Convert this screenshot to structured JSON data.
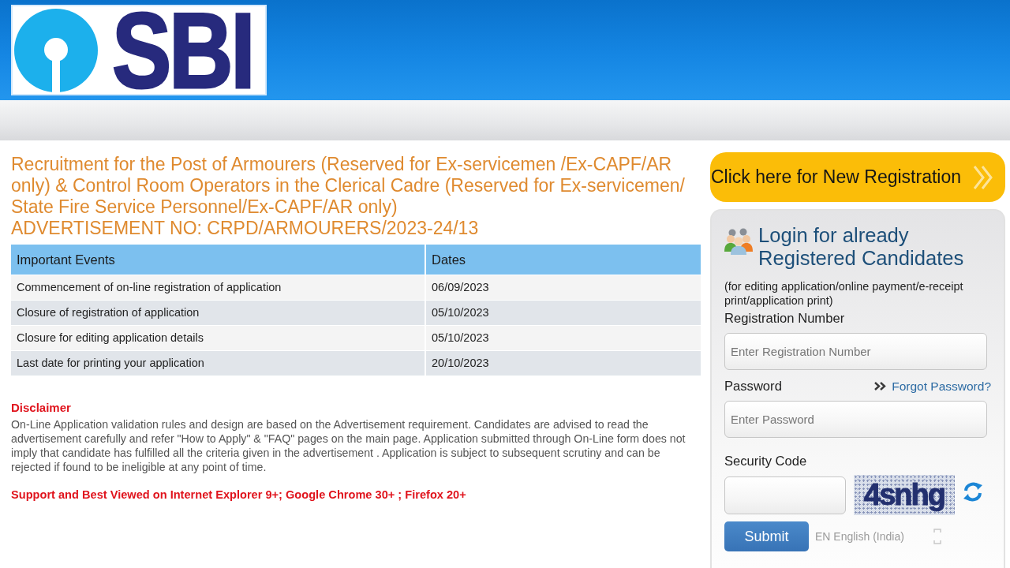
{
  "header": {
    "logo_text": "SBI"
  },
  "recruitment": {
    "title": "Recruitment for the Post of Armourers (Reserved for Ex-servicemen /Ex-CAPF/AR only) & Control Room Operators in the Clerical Cadre (Reserved for Ex-servicemen/ State Fire Service Personnel/Ex-CAPF/AR only)",
    "advertisement_no": "ADVERTISEMENT NO: CRPD/ARMOURERS/2023-24/13"
  },
  "events_table": {
    "columns": [
      "Important Events",
      "Dates"
    ],
    "rows": [
      {
        "event": "Commencement of on-line registration of application",
        "date": "06/09/2023"
      },
      {
        "event": "Closure of registration of application",
        "date": "05/10/2023"
      },
      {
        "event": "Closure for editing application details",
        "date": "05/10/2023"
      },
      {
        "event": "Last date for printing your application",
        "date": "20/10/2023"
      }
    ]
  },
  "disclaimer": {
    "heading": "Disclaimer",
    "text": "On-Line Application validation rules and design are based on the Advertisement requirement. Candidates are advised to read the advertisement carefully and refer \"How to Apply\" & \"FAQ\" pages on the main page. Application submitted through On-Line form does not imply that candidate has fulfilled all the criteria given in the advertisement . Application is subject to subsequent scrutiny and can be rejected if found to be ineligible at any point of time."
  },
  "browser_support": "Support and Best Viewed on Internet Explorer 9+; Google Chrome 30+ ; Firefox 20+",
  "new_registration_button": "Click here for New Registration",
  "login_panel": {
    "title": "Login for already Registered Candidates",
    "note": "(for editing application/online payment/e-receipt print/application print)",
    "registration_number": {
      "label": "Registration Number",
      "placeholder": "Enter Registration Number"
    },
    "password": {
      "label": "Password",
      "placeholder": "Enter Password",
      "forgot_link": "Forgot Password?"
    },
    "security_code": {
      "label": "Security Code",
      "captcha": "4snhg"
    },
    "submit_button": "Submit"
  },
  "language_bar": {
    "code": "EN",
    "language": "English (India)"
  }
}
